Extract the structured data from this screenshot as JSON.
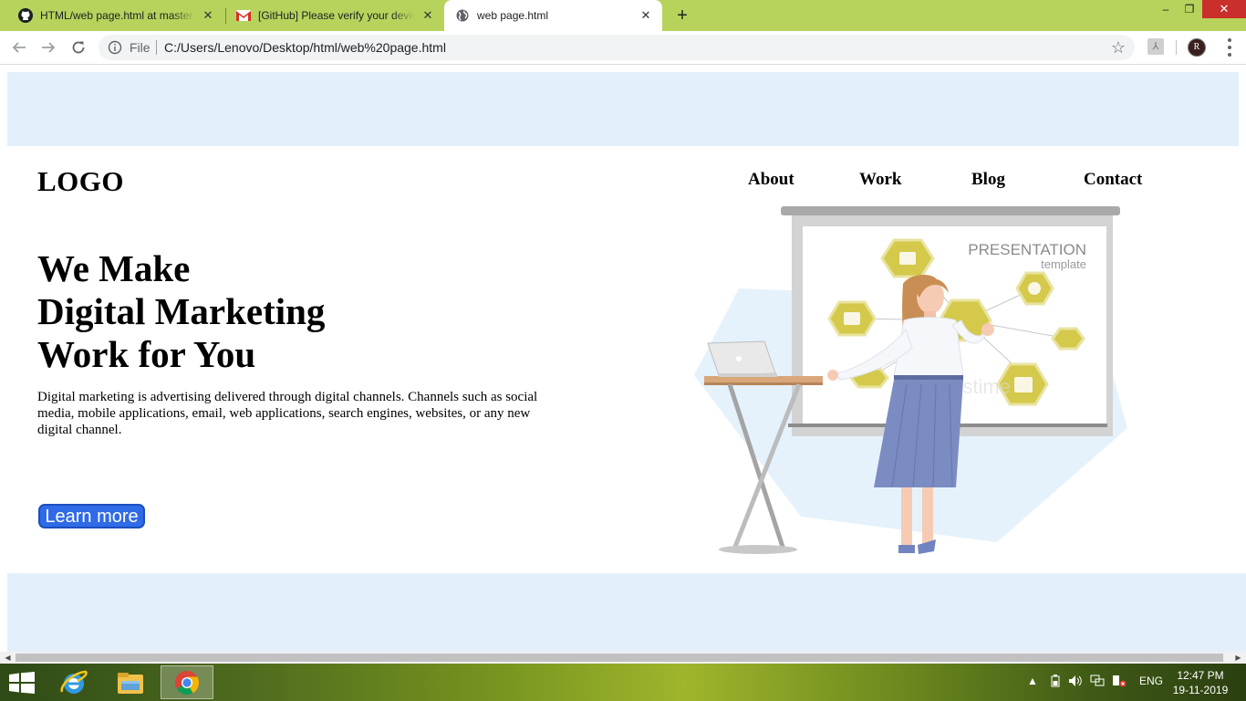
{
  "browser": {
    "tabs": [
      {
        "title": "HTML/web page.html at master",
        "favicon": "github-icon",
        "active": false
      },
      {
        "title": "[GitHub] Please verify your device",
        "favicon": "gmail-icon",
        "active": false
      },
      {
        "title": "web page.html",
        "favicon": "globe-icon",
        "active": true
      }
    ],
    "new_tab": "+",
    "window_controls": {
      "minimize": "–",
      "maximize": "❐",
      "close": "✕"
    },
    "address": {
      "scheme_label": "File",
      "url": "C:/Users/Lenovo/Desktop/html/web%20page.html"
    },
    "profile_initial": "R",
    "accent_color": "#b7d35c"
  },
  "page": {
    "logo": "LOGO",
    "nav": [
      "About",
      "Work",
      "Blog",
      "Contact"
    ],
    "headline": [
      "We Make",
      "Digital Marketing",
      "Work for You"
    ],
    "description": "Digital marketing is advertising delivered through digital channels. Channels such as social media, mobile applications, email, web applications, search engines, websites, or any new digital channel.",
    "cta_label": "Learn more",
    "band_color": "#e3f0fb",
    "cta_color": "#2f6be6"
  },
  "hero_image": {
    "title": "PRESENTATION",
    "subtitle": "template",
    "watermark": "dreamstime"
  },
  "taskbar": {
    "pinned": [
      "internet-explorer-icon",
      "file-explorer-icon",
      "chrome-icon"
    ],
    "language": "ENG",
    "time": "12:47 PM",
    "date": "19-11-2019"
  }
}
